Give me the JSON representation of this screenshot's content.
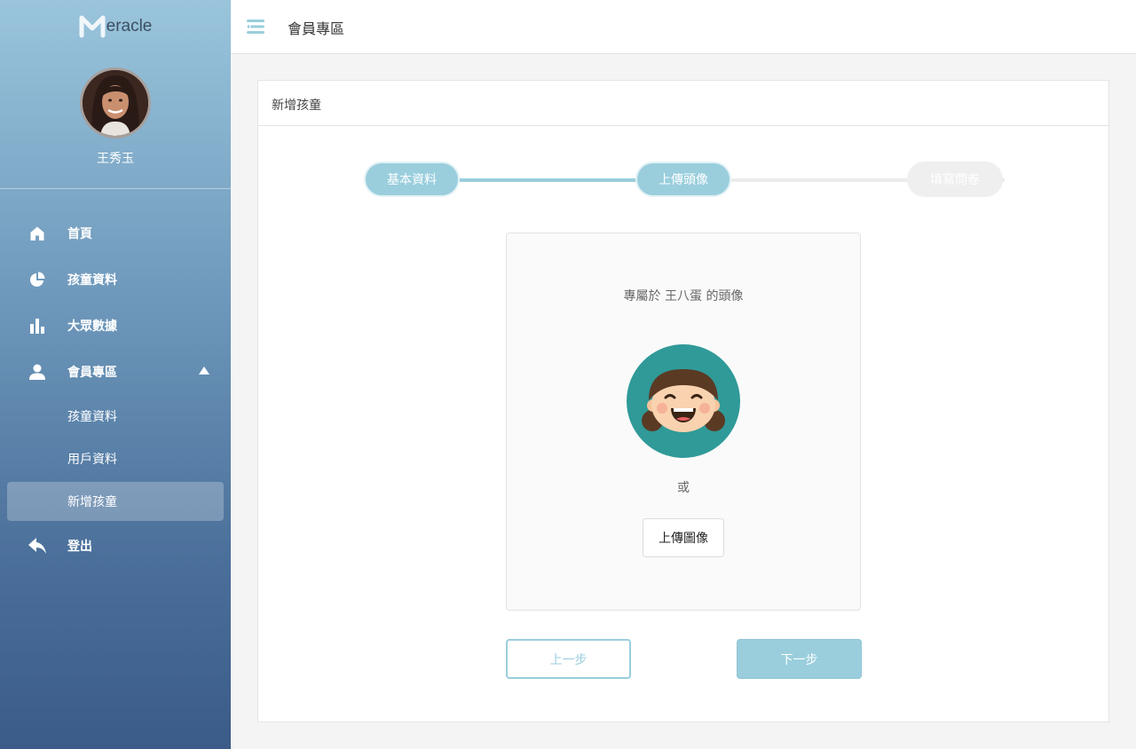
{
  "brand": {
    "logo_text": "eracle"
  },
  "user": {
    "name": "王秀玉"
  },
  "sidebar": {
    "items": [
      {
        "label": "首頁",
        "icon": "home-icon"
      },
      {
        "label": "孩童資料",
        "icon": "pie-chart-icon"
      },
      {
        "label": "大眾數據",
        "icon": "bar-chart-icon"
      },
      {
        "label": "會員專區",
        "icon": "user-icon",
        "expanded": true
      },
      {
        "label": "登出",
        "icon": "logout-icon"
      }
    ],
    "sub_items": [
      {
        "label": "孩童資料"
      },
      {
        "label": "用戶資料"
      },
      {
        "label": "新增孩童",
        "active": true
      }
    ]
  },
  "header": {
    "title": "會員專區",
    "menu_icon": "menu-icon"
  },
  "card": {
    "title": "新增孩童"
  },
  "stepper": {
    "steps": [
      {
        "label": "基本資料",
        "state": "done"
      },
      {
        "label": "上傳頭像",
        "state": "active"
      },
      {
        "label": "填寫問卷",
        "state": "todo"
      }
    ]
  },
  "upload": {
    "caption": "專屬於 王八蛋 的頭像",
    "or": "或",
    "button": "上傳圖像"
  },
  "actions": {
    "prev": "上一步",
    "next": "下一步"
  },
  "colors": {
    "accent": "#9acedd",
    "avatar_bg": "#2f9a98",
    "sidebar_top": "#9ac5dc",
    "sidebar_bottom": "#3b5b88"
  }
}
